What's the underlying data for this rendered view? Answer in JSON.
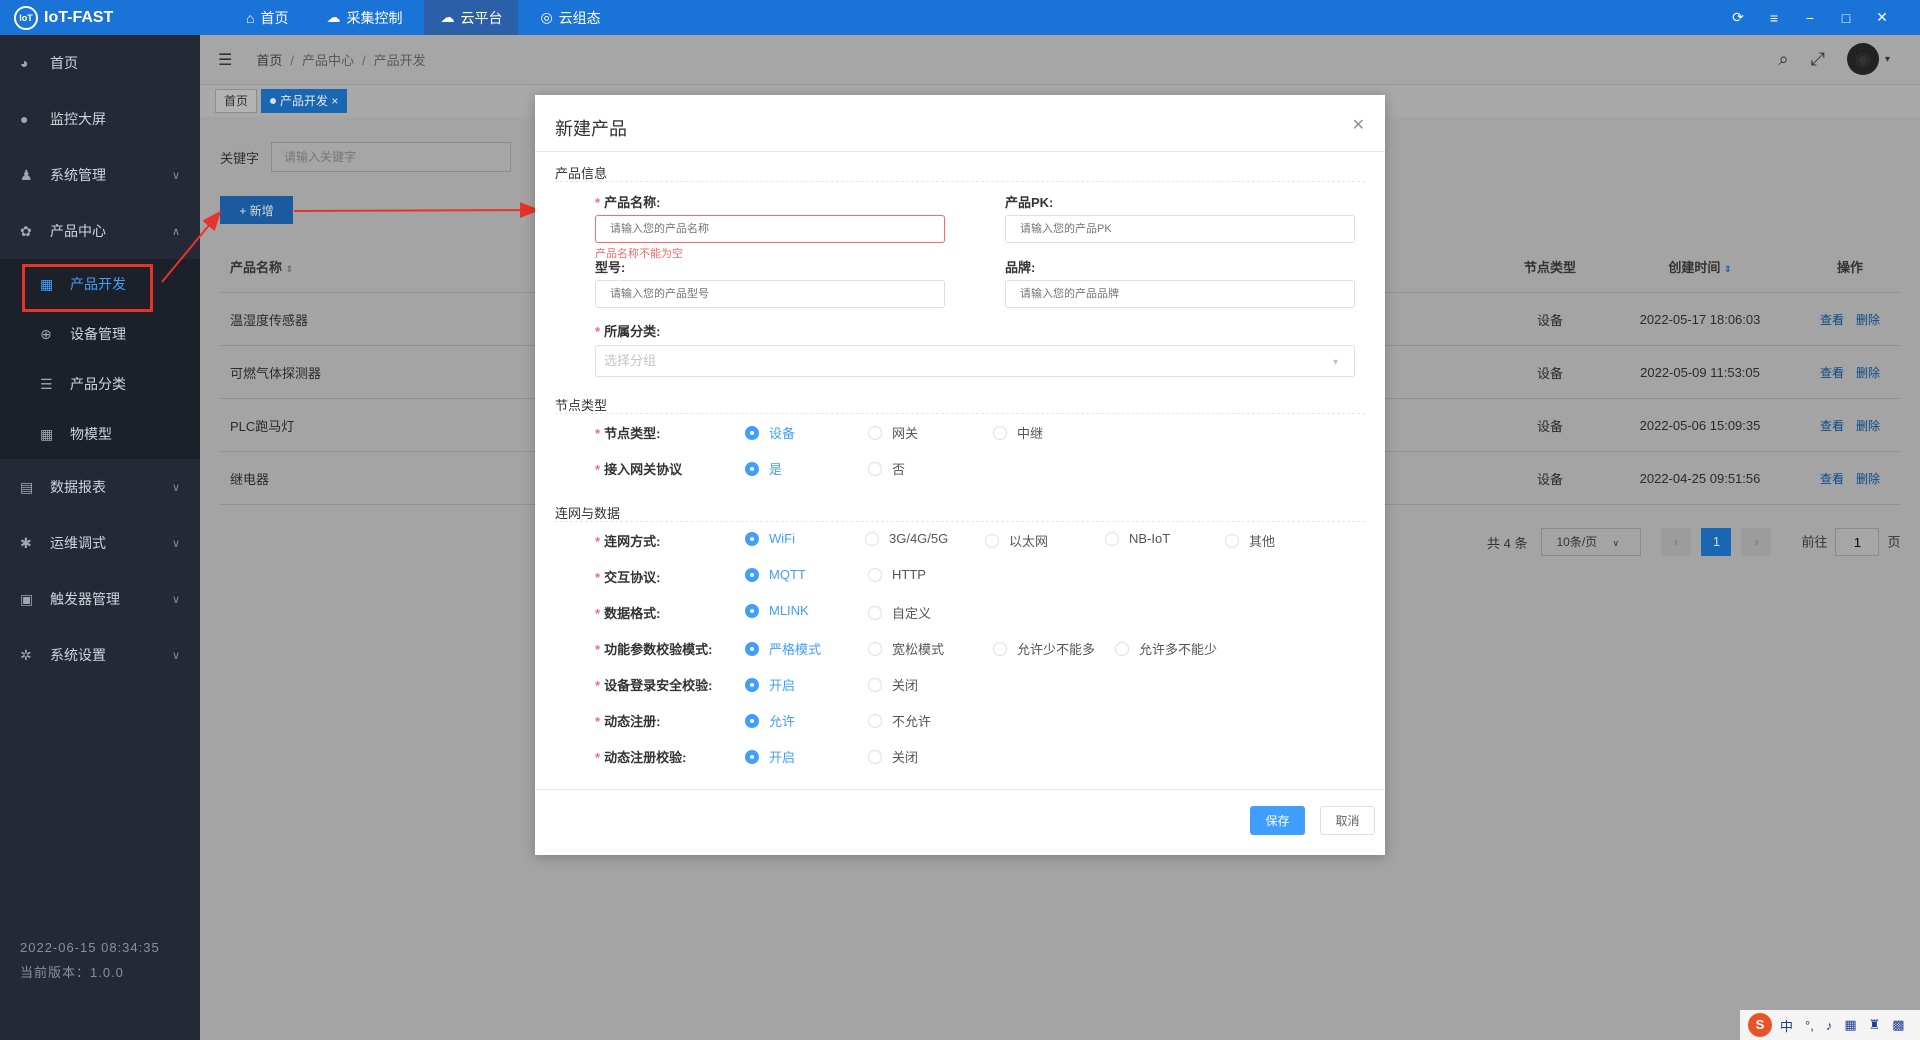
{
  "app": {
    "title": "IoT-FAST",
    "logo_text": "IoT"
  },
  "top_nav": [
    {
      "label": "首页"
    },
    {
      "label": "采集控制"
    },
    {
      "label": "云平台"
    },
    {
      "label": "云组态"
    }
  ],
  "sidebar": {
    "items": [
      {
        "label": "首页"
      },
      {
        "label": "监控大屏"
      },
      {
        "label": "系统管理"
      },
      {
        "label": "产品中心"
      }
    ],
    "sub_items": [
      {
        "label": "产品开发"
      },
      {
        "label": "设备管理"
      },
      {
        "label": "产品分类"
      },
      {
        "label": "物模型"
      }
    ],
    "more_items": [
      {
        "label": "数据报表"
      },
      {
        "label": "运维调式"
      },
      {
        "label": "触发器管理"
      },
      {
        "label": "系统设置"
      }
    ],
    "footer_time": "2022-06-15 08:34:35",
    "footer_version": "当前版本：1.0.0"
  },
  "breadcrumb": {
    "home": "首页",
    "level1": "产品中心",
    "level2": "产品开发"
  },
  "tags": {
    "home": "首页",
    "current": "产品开发"
  },
  "filter": {
    "label": "关键字",
    "placeholder": "请输入关键字"
  },
  "add_button": "+ 新增",
  "table": {
    "headers": {
      "name": "产品名称",
      "node": "节点类型",
      "time": "创建时间",
      "ops": "操作"
    },
    "rows": [
      {
        "name": "温湿度传感器",
        "node": "设备",
        "time": "2022-05-17 18:06:03"
      },
      {
        "name": "可燃气体探测器",
        "node": "设备",
        "time": "2022-05-09 11:53:05"
      },
      {
        "name": "PLC跑马灯",
        "node": "设备",
        "time": "2022-05-06 15:09:35"
      },
      {
        "name": "继电器",
        "node": "设备",
        "time": "2022-04-25 09:51:56"
      }
    ],
    "op_view": "查看",
    "op_delete": "删除"
  },
  "pagination": {
    "total": "共 4 条",
    "page_size": "10条/页",
    "current_page": "1",
    "goto_prefix": "前往",
    "goto_value": "1",
    "goto_suffix": "页"
  },
  "dialog": {
    "title": "新建产品",
    "section_info": "产品信息",
    "name_label": "产品名称:",
    "name_placeholder": "请输入您的产品名称",
    "name_error": "产品名称不能为空",
    "pk_label": "产品PK:",
    "pk_placeholder": "请输入您的产品PK",
    "model_label": "型号:",
    "model_placeholder": "请输入您的产品型号",
    "brand_label": "品牌:",
    "brand_placeholder": "请输入您的产品品牌",
    "category_label": "所属分类:",
    "category_placeholder": "选择分组",
    "section_node": "节点类型",
    "node_label": "节点类型:",
    "node_options": [
      "设备",
      "网关",
      "中继"
    ],
    "gateway_label": "接入网关协议",
    "gateway_options": [
      "是",
      "否"
    ],
    "section_net": "连网与数据",
    "net_label": "连网方式:",
    "net_options": [
      "WiFi",
      "3G/4G/5G",
      "以太网",
      "NB-IoT",
      "其他"
    ],
    "proto_label": "交互协议:",
    "proto_options": [
      "MQTT",
      "HTTP"
    ],
    "format_label": "数据格式:",
    "format_options": [
      "MLINK",
      "自定义"
    ],
    "check_label": "功能参数校验模式:",
    "check_options": [
      "严格模式",
      "宽松模式",
      "允许少不能多",
      "允许多不能少"
    ],
    "login_label": "设备登录安全校验:",
    "login_options": [
      "开启",
      "关闭"
    ],
    "dyn_label": "动态注册:",
    "dyn_options": [
      "允许",
      "不允许"
    ],
    "dyncheck_label": "动态注册校验:",
    "dyncheck_options": [
      "开启",
      "关闭"
    ],
    "save": "保存",
    "cancel": "取消"
  },
  "ime": {
    "lang": "中"
  }
}
